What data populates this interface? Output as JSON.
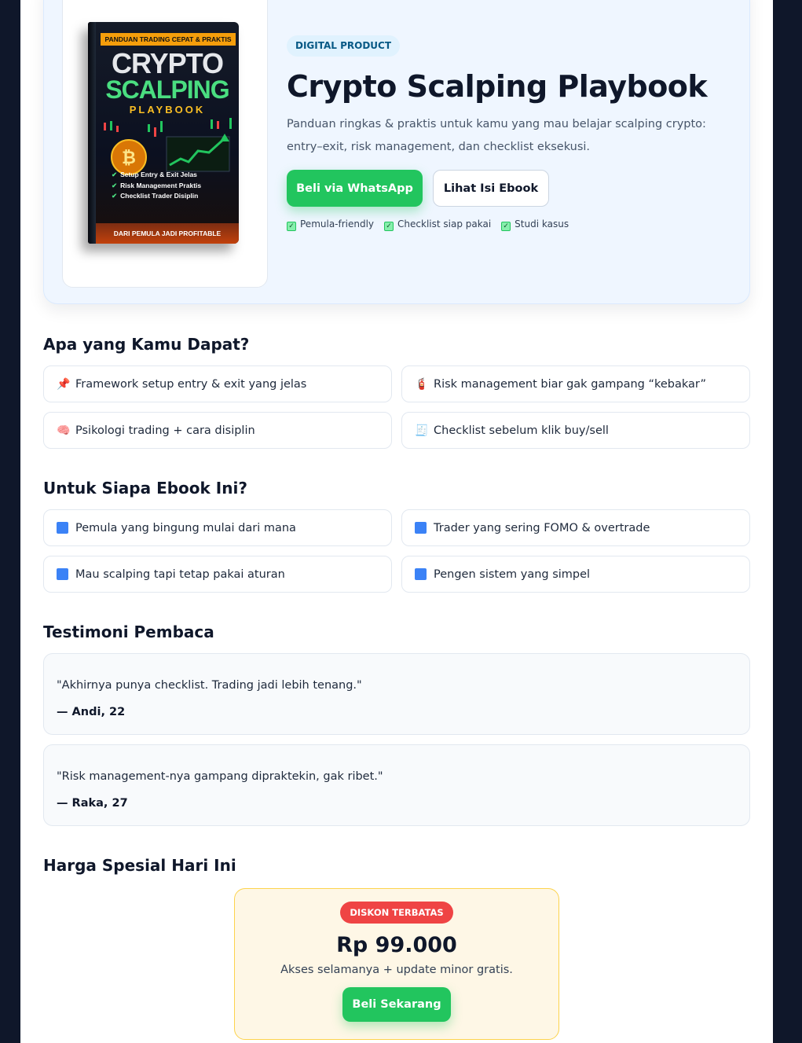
{
  "hero": {
    "badge": "DIGITAL PRODUCT",
    "title": "Crypto Scalping Playbook",
    "description": "Panduan ringkas & praktis untuk kamu yang mau belajar scalping crypto: entry–exit, risk management, dan checklist eksekusi.",
    "primary_button": "Beli via WhatsApp",
    "secondary_button": "Lihat Isi Ebook",
    "checks": [
      "Pemula-friendly",
      "Checklist siap pakai",
      "Studi kasus"
    ],
    "book_cover": {
      "ribbon": "PANDUAN TRADING CEPAT & PRAKTIS",
      "title_line1": "CRYPTO",
      "title_line2": "SCALPING",
      "title_line3": "PLAYBOOK",
      "bullets": [
        "Setup Entry & Exit Jelas",
        "Risk Management Praktis",
        "Checklist Trader Disiplin"
      ],
      "footer": "DARI PEMULA JADI PROFITABLE"
    }
  },
  "benefits": {
    "heading": "Apa yang Kamu Dapat?",
    "items": [
      {
        "icon": "pushpin-icon",
        "glyph": "📌",
        "label": "Framework setup entry & exit yang jelas"
      },
      {
        "icon": "fire-extinguisher-icon",
        "glyph": "🧯",
        "label": "Risk management biar gak gampang “kebakar”"
      },
      {
        "icon": "brain-icon",
        "glyph": "🧠",
        "label": "Psikologi trading + cara disiplin"
      },
      {
        "icon": "receipt-icon",
        "glyph": "🧾",
        "label": "Checklist sebelum klik buy/sell"
      }
    ]
  },
  "audience": {
    "heading": "Untuk Siapa Ebook Ini?",
    "items": [
      {
        "label": "Pemula yang bingung mulai dari mana"
      },
      {
        "label": "Trader yang sering FOMO & overtrade"
      },
      {
        "label": "Mau scalping tapi tetap pakai aturan"
      },
      {
        "label": "Pengen sistem yang simpel"
      }
    ]
  },
  "testimonials": {
    "heading": "Testimoni Pembaca",
    "items": [
      {
        "quote": "\"Akhirnya punya checklist. Trading jadi lebih tenang.\"",
        "author": "— Andi, 22"
      },
      {
        "quote": "\"Risk management-nya gampang dipraktekin, gak ribet.\"",
        "author": "— Raka, 27"
      }
    ]
  },
  "pricing": {
    "heading": "Harga Spesial Hari Ini",
    "badge": "DISKON TERBATAS",
    "price": "Rp 99.000",
    "subtitle": "Akses selamanya + update minor gratis.",
    "button": "Beli Sekarang"
  },
  "colors": {
    "accent_green": "#22c55e",
    "badge_red": "#ef4444",
    "page_bg": "#0f172a"
  }
}
